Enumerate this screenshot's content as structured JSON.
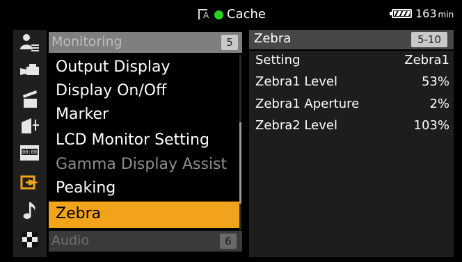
{
  "status": {
    "cache_label": "Cache",
    "clip_icon": "clip-a-icon",
    "rec_dot_color": "#27d31f",
    "remaining_value": "163",
    "remaining_unit": "min"
  },
  "icons": [
    {
      "name": "user-settings-icon"
    },
    {
      "name": "camera-icon"
    },
    {
      "name": "clapperboard-icon"
    },
    {
      "name": "scene-file-icon"
    },
    {
      "name": "timecode-icon"
    },
    {
      "name": "output-icon"
    },
    {
      "name": "audio-note-icon"
    },
    {
      "name": "checker-icon"
    }
  ],
  "menu": {
    "header_label": "Monitoring",
    "header_number": "5",
    "items": [
      {
        "label": "Output Display"
      },
      {
        "label": "Display On/Off"
      },
      {
        "label": "Marker"
      },
      {
        "label": "LCD Monitor Setting"
      },
      {
        "label": "Gamma Display Assist"
      },
      {
        "label": "Peaking"
      }
    ],
    "selected_label": "Zebra",
    "footer_label": "Audio",
    "footer_number": "6"
  },
  "detail": {
    "title": "Zebra",
    "code": "5-10",
    "rows": [
      {
        "label": "Setting",
        "value": "Zebra1"
      },
      {
        "label": "Zebra1 Level",
        "value": "53%"
      },
      {
        "label": "Zebra1 Aperture",
        "value": "2%"
      },
      {
        "label": "Zebra2 Level",
        "value": "103%"
      }
    ]
  },
  "colors": {
    "accent": "#f2a31c",
    "header_gray": "#7f7f7f",
    "panel_bg": "#1d1d1d"
  }
}
